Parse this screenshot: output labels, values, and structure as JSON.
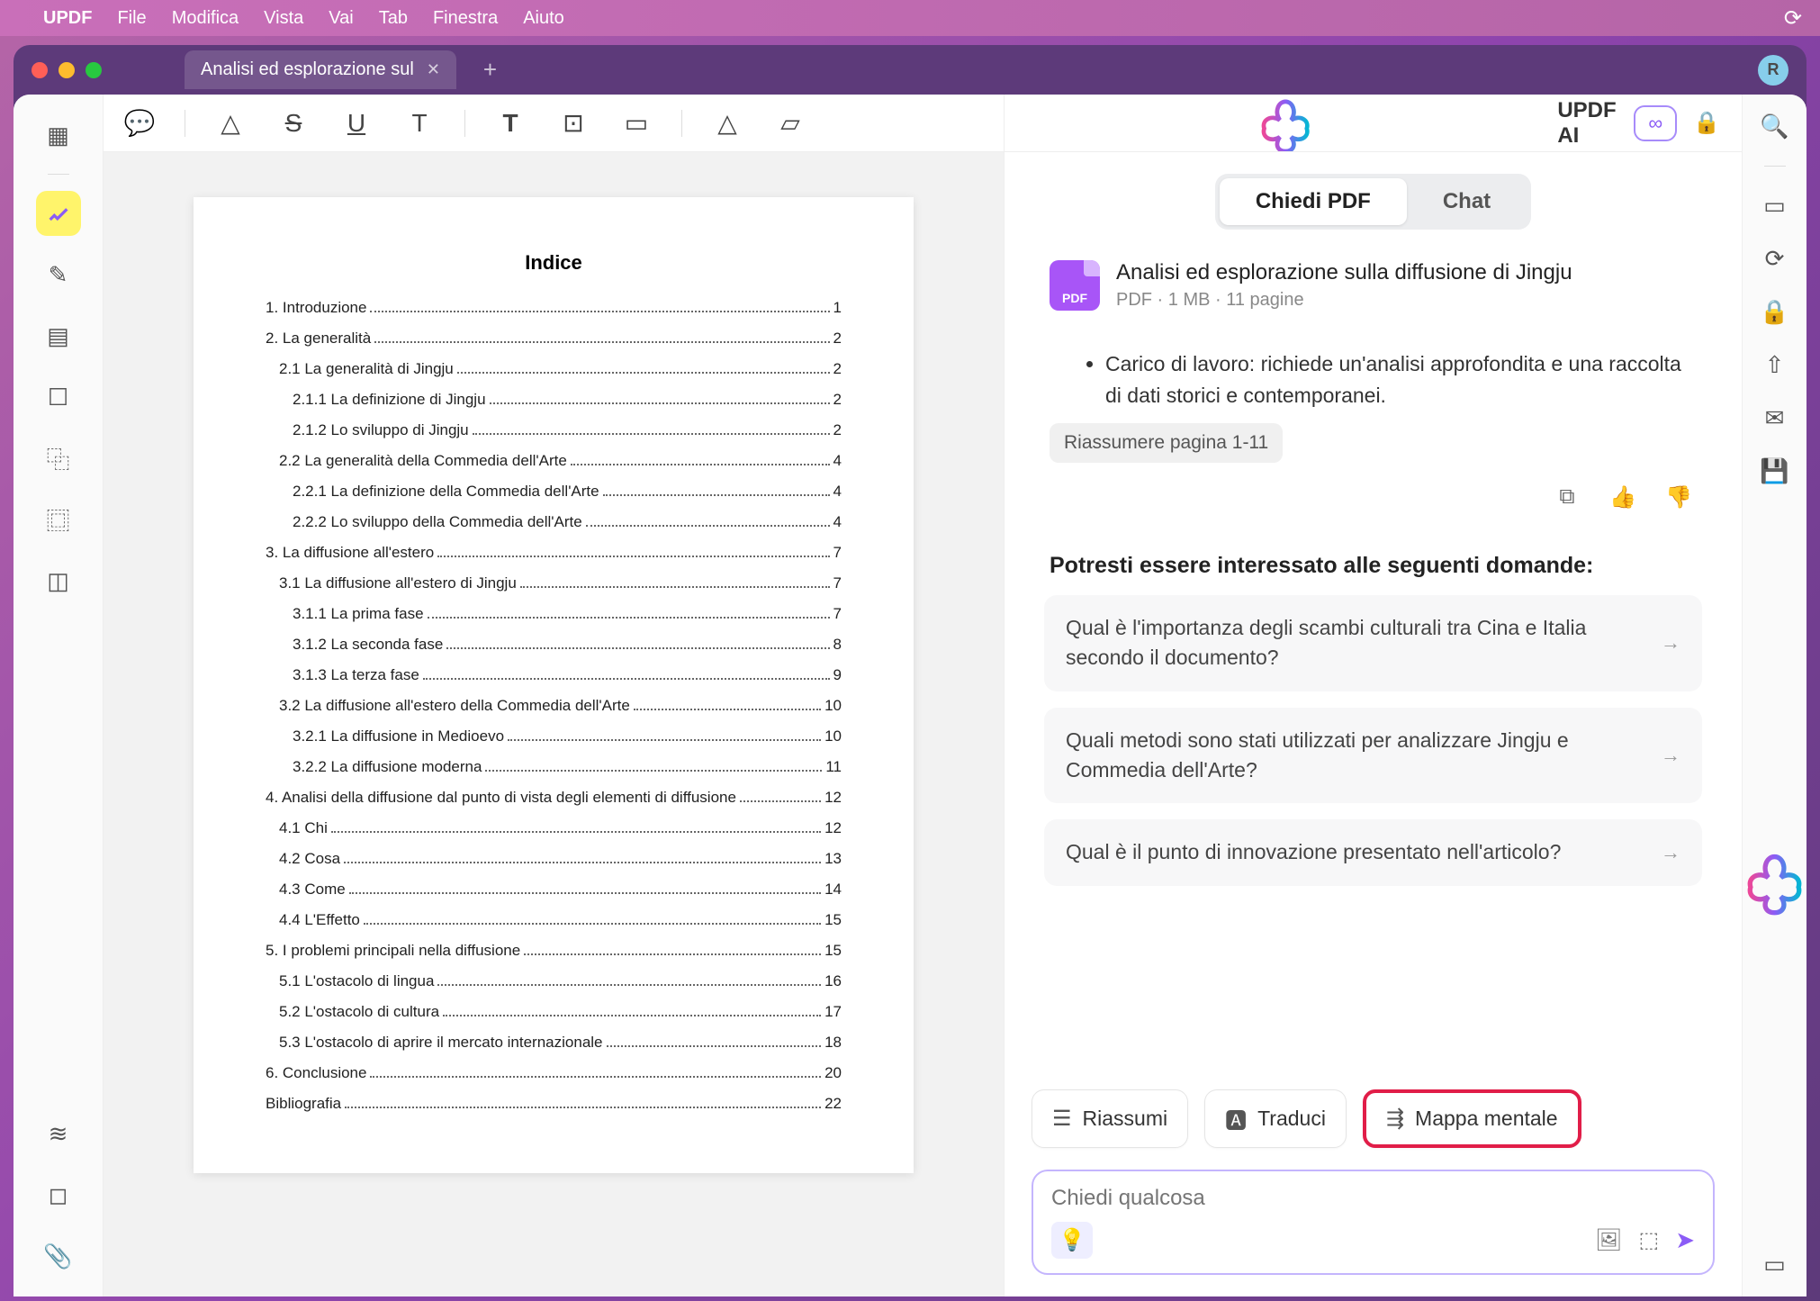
{
  "menubar": {
    "app": "UPDF",
    "items": [
      "File",
      "Modifica",
      "Vista",
      "Vai",
      "Tab",
      "Finestra",
      "Aiuto"
    ]
  },
  "window": {
    "tab_title": "Analisi ed esplorazione sul",
    "avatar_letter": "R"
  },
  "document": {
    "page_title": "Indice",
    "toc": [
      {
        "indent": 0,
        "text": "1. Introduzione",
        "page": "1"
      },
      {
        "indent": 0,
        "text": "2. La generalità",
        "page": "2"
      },
      {
        "indent": 1,
        "text": "2.1 La generalità di Jingju",
        "page": "2"
      },
      {
        "indent": 2,
        "text": "2.1.1 La definizione di Jingju",
        "page": "2"
      },
      {
        "indent": 2,
        "text": "2.1.2 Lo sviluppo di Jingju",
        "page": "2"
      },
      {
        "indent": 1,
        "text": "2.2 La generalità della Commedia dell'Arte",
        "page": "4"
      },
      {
        "indent": 2,
        "text": "2.2.1 La definizione della Commedia dell'Arte",
        "page": "4"
      },
      {
        "indent": 2,
        "text": "2.2.2 Lo sviluppo della Commedia dell'Arte",
        "page": "4"
      },
      {
        "indent": 0,
        "text": "3. La diffusione all'estero",
        "page": "7"
      },
      {
        "indent": 1,
        "text": "3.1 La diffusione all'estero di Jingju",
        "page": "7"
      },
      {
        "indent": 2,
        "text": "3.1.1 La prima fase",
        "page": "7"
      },
      {
        "indent": 2,
        "text": "3.1.2 La seconda fase",
        "page": "8"
      },
      {
        "indent": 2,
        "text": "3.1.3 La terza fase",
        "page": "9"
      },
      {
        "indent": 1,
        "text": "3.2 La diffusione all'estero della Commedia dell'Arte",
        "page": "10"
      },
      {
        "indent": 2,
        "text": "3.2.1 La diffusione in Medioevo",
        "page": "10"
      },
      {
        "indent": 2,
        "text": "3.2.2 La diffusione moderna",
        "page": "11"
      },
      {
        "indent": 0,
        "text": "4. Analisi della diffusione dal punto di vista degli elementi di diffusione",
        "page": "12"
      },
      {
        "indent": 1,
        "text": "4.1 Chi",
        "page": "12"
      },
      {
        "indent": 1,
        "text": "4.2 Cosa",
        "page": "13"
      },
      {
        "indent": 1,
        "text": "4.3 Come",
        "page": "14"
      },
      {
        "indent": 1,
        "text": "4.4 L'Effetto",
        "page": "15"
      },
      {
        "indent": 0,
        "text": "5. I problemi principali nella diffusione",
        "page": "15"
      },
      {
        "indent": 1,
        "text": "5.1 L'ostacolo di lingua",
        "page": "16"
      },
      {
        "indent": 1,
        "text": "5.2 L'ostacolo di cultura",
        "page": "17"
      },
      {
        "indent": 1,
        "text": "5.3 L'ostacolo di aprire il mercato internazionale",
        "page": "18"
      },
      {
        "indent": 0,
        "text": "6. Conclusione",
        "page": "20"
      },
      {
        "indent": 0,
        "text": "Bibliografia",
        "page": "22"
      }
    ]
  },
  "ai": {
    "title": "UPDF AI",
    "tabs": {
      "ask": "Chiedi PDF",
      "chat": "Chat"
    },
    "doc": {
      "title": "Analisi ed esplorazione sulla diffusione di Jingju",
      "meta": "PDF · 1 MB · 11 pagine",
      "icon_label": "PDF"
    },
    "response_bullet": "Carico di lavoro: richiede un'analisi approfondita e una raccolta di dati storici e contemporanei.",
    "summary_chip": "Riassumere pagina 1-11",
    "suggest_title": "Potresti essere interessato alle seguenti domande:",
    "suggestions": [
      "Qual è l'importanza degli scambi culturali tra Cina e Italia secondo il documento?",
      "Quali metodi sono stati utilizzati per analizzare Jingju e Commedia dell'Arte?",
      "Qual è il punto di innovazione presentato nell'articolo?"
    ],
    "quick": {
      "summarize": "Riassumi",
      "translate": "Traduci",
      "mindmap": "Mappa mentale"
    },
    "input_placeholder": "Chiedi qualcosa"
  }
}
